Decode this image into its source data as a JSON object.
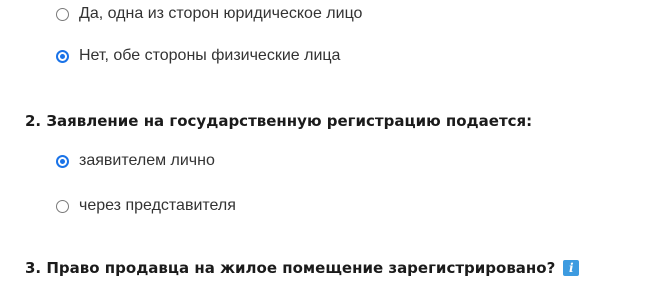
{
  "question1": {
    "options": [
      {
        "label": "Да, одна из сторон юридическое лицо",
        "selected": false
      },
      {
        "label": "Нет, обе стороны физические лица",
        "selected": true
      }
    ]
  },
  "question2": {
    "title": "2. Заявление на государственную регистрацию подается:",
    "options": [
      {
        "label": "заявителем лично",
        "selected": true
      },
      {
        "label": "через представителя",
        "selected": false
      }
    ]
  },
  "question3": {
    "title": "3. Право продавца на жилое помещение зарегистрировано?",
    "info_icon": "info-icon",
    "info_icon_glyph": "i"
  },
  "colors": {
    "accent": "#1a73e8",
    "info_icon": "#3d9be0"
  }
}
